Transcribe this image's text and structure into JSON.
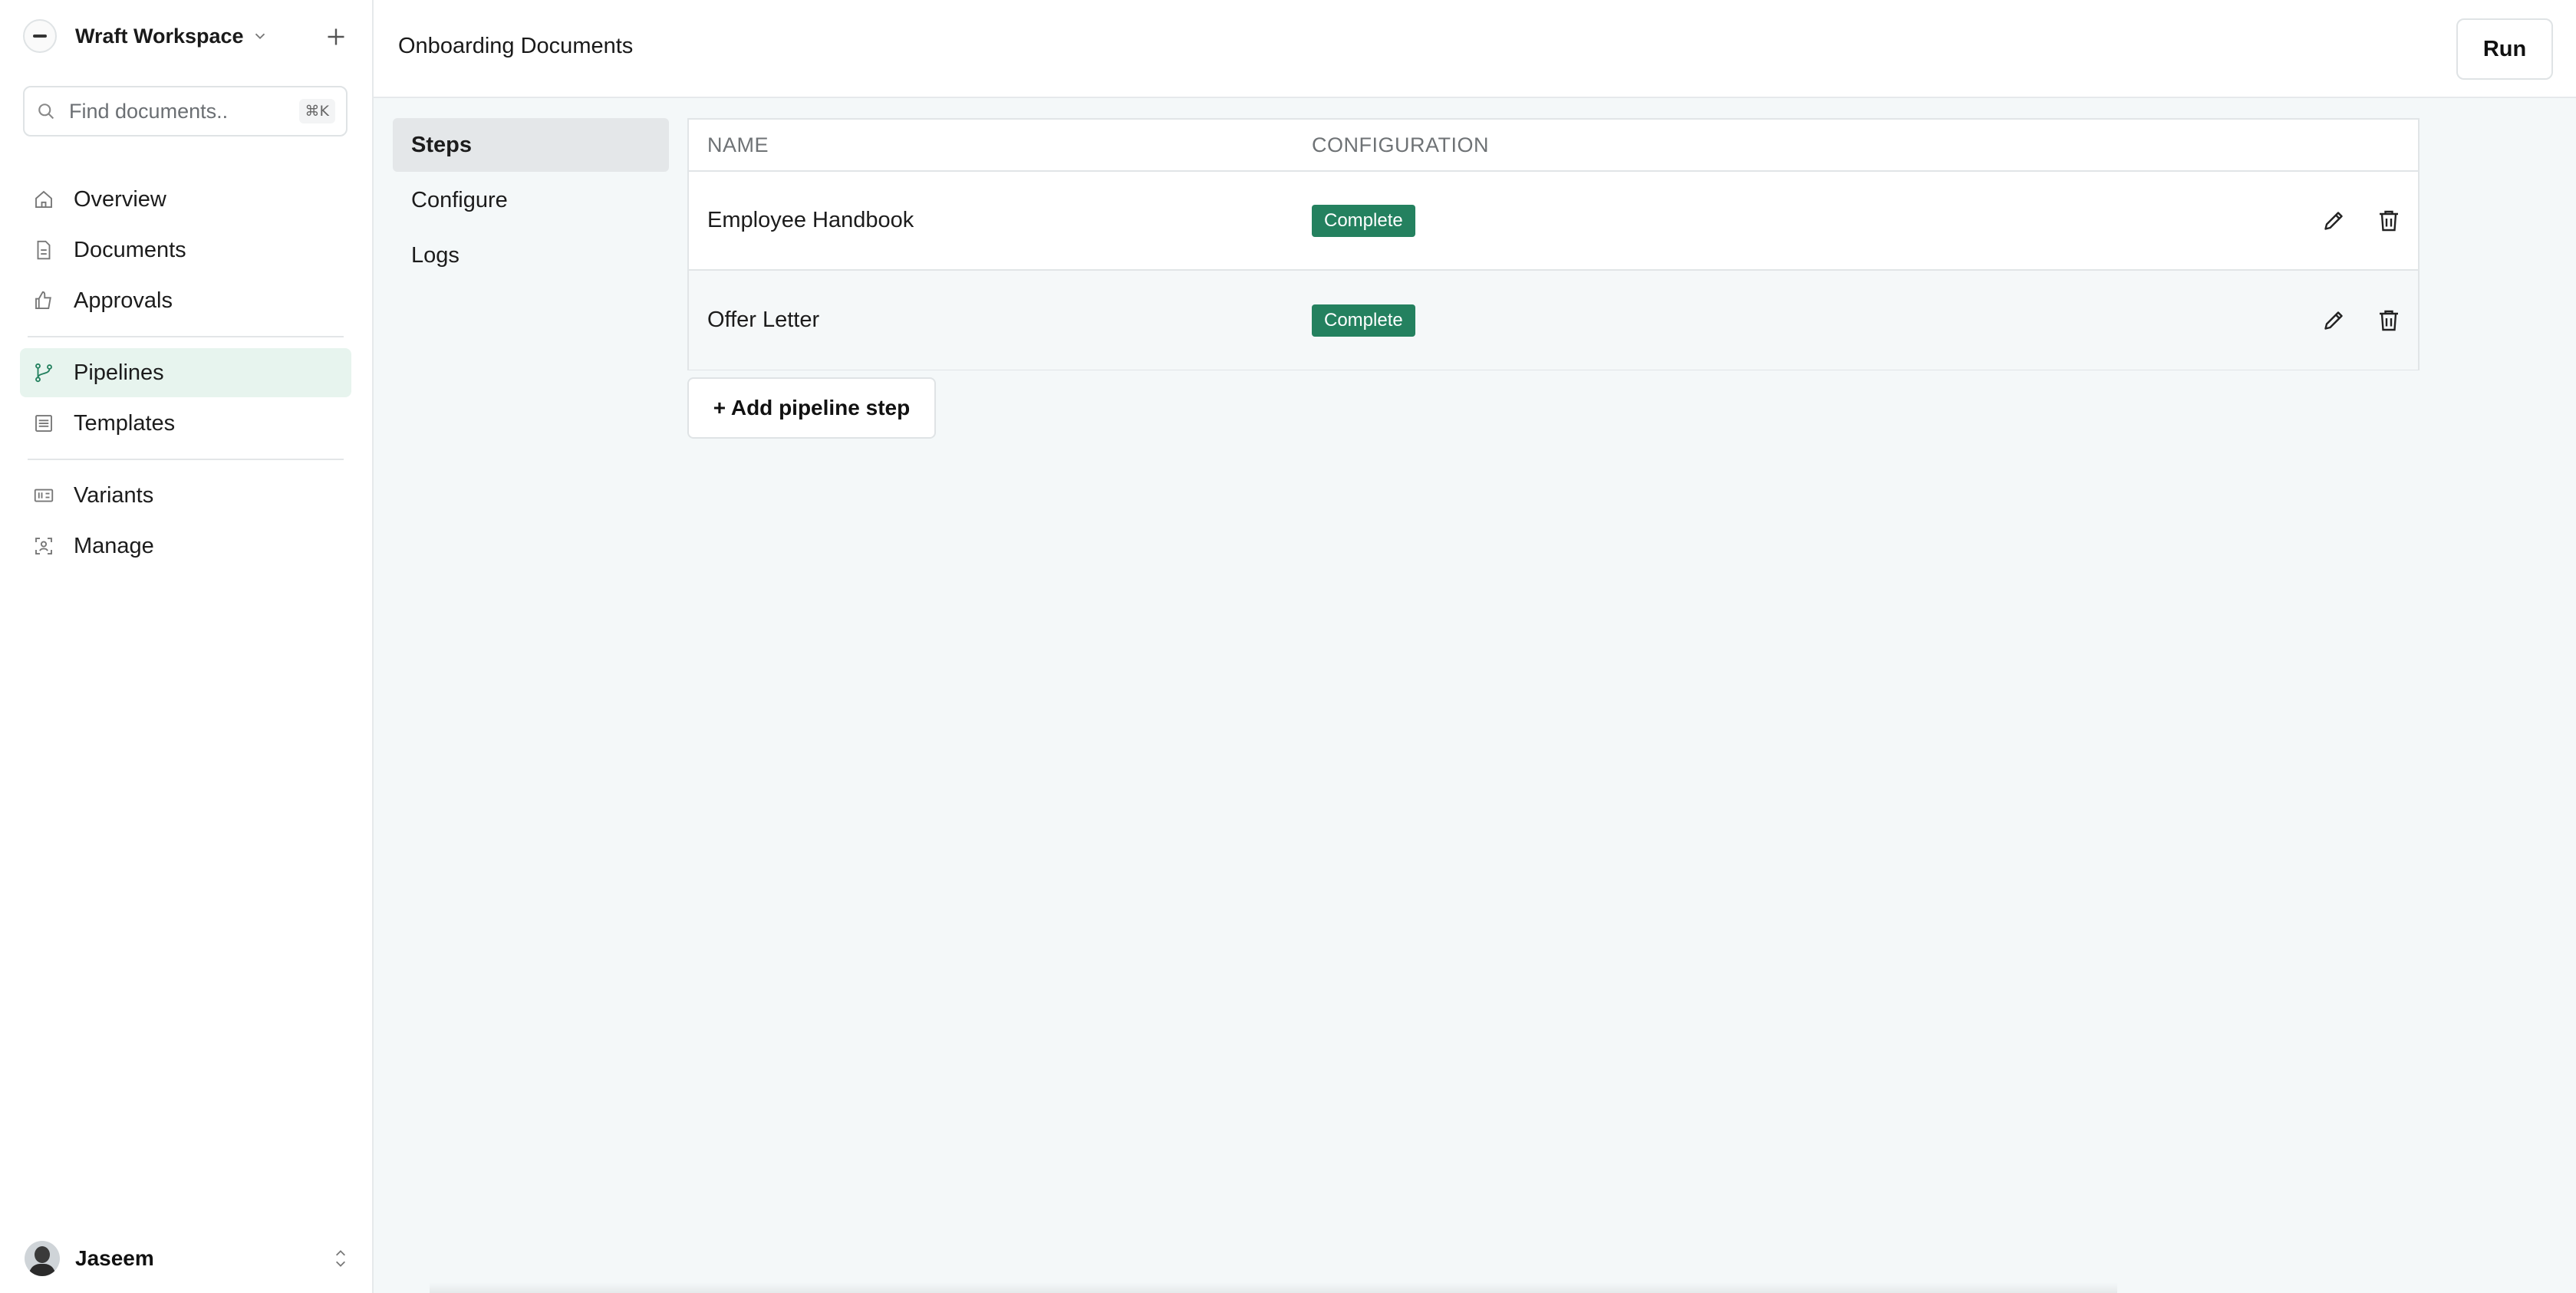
{
  "workspace": {
    "name": "Wraft Workspace"
  },
  "search": {
    "placeholder": "Find documents..",
    "shortcut": "⌘K"
  },
  "sidebar": {
    "primary": [
      {
        "label": "Overview",
        "icon": "home-icon"
      },
      {
        "label": "Documents",
        "icon": "document-icon"
      },
      {
        "label": "Approvals",
        "icon": "thumbs-up-icon"
      }
    ],
    "secondary": [
      {
        "label": "Pipelines",
        "icon": "git-branch-icon",
        "active": true
      },
      {
        "label": "Templates",
        "icon": "template-icon"
      }
    ],
    "tertiary": [
      {
        "label": "Variants",
        "icon": "variant-icon"
      },
      {
        "label": "Manage",
        "icon": "manage-icon"
      }
    ]
  },
  "user": {
    "name": "Jaseem"
  },
  "header": {
    "title": "Onboarding Documents",
    "run_label": "Run"
  },
  "subnav": [
    {
      "label": "Steps",
      "active": true
    },
    {
      "label": "Configure"
    },
    {
      "label": "Logs"
    }
  ],
  "table": {
    "columns": [
      "NAME",
      "CONFIGURATION"
    ],
    "rows": [
      {
        "name": "Employee Handbook",
        "status": "Complete"
      },
      {
        "name": "Offer Letter",
        "status": "Complete"
      }
    ]
  },
  "add_step_label": "+ Add pipeline step",
  "colors": {
    "accent": "#24815f",
    "active_nav_bg": "#e7f4ee"
  }
}
